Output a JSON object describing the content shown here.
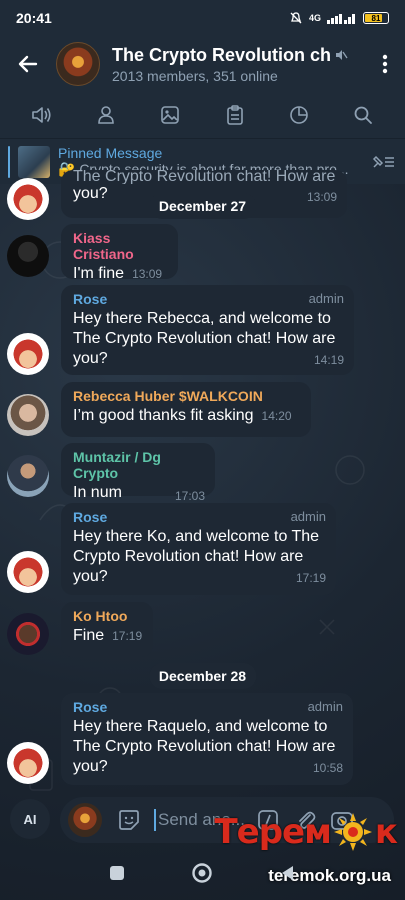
{
  "status_bar": {
    "time": "20:41",
    "network": "4G",
    "battery": "81"
  },
  "header": {
    "title": "The Crypto Revolution chat",
    "subtitle": "2013 members, 351 online",
    "icons": [
      "back-arrow-icon",
      "muted-icon",
      "more-vert-icon"
    ]
  },
  "tabs": [
    {
      "icon": "speaker-icon"
    },
    {
      "icon": "person-icon"
    },
    {
      "icon": "image-icon"
    },
    {
      "icon": "clipboard-icon"
    },
    {
      "icon": "pie-chart-icon"
    },
    {
      "icon": "search-icon"
    }
  ],
  "pinned": {
    "title": "Pinned Message",
    "body": "🔐 Crypto security is about far more than pro..."
  },
  "messages": {
    "top_partial": {
      "text": "you?",
      "time": "13:09",
      "partial_text": "The Crypto Revolution chat! How are"
    },
    "date1": "December 27",
    "m1": {
      "sender": "Kiass Cristiano",
      "sender_color": "#f0668a",
      "text": "I'm fine",
      "time": "13:09"
    },
    "m2": {
      "sender": "Rose",
      "sender_color": "#5fa9e0",
      "role": "admin",
      "text": "Hey there Rebecca, and welcome to The Crypto Revolution chat! How are you?",
      "time": "14:19"
    },
    "m3": {
      "sender": "Rebecca Huber $WALKCOIN",
      "sender_color": "#f0a95a",
      "text": "I’m good thanks fit asking",
      "time": "14:20"
    },
    "m4": {
      "sender": "Muntazir / Dg Crypto",
      "sender_color": "#5ec4a8",
      "text": "In num",
      "time": "17:03"
    },
    "m5": {
      "sender": "Rose",
      "sender_color": "#5fa9e0",
      "role": "admin",
      "text": "Hey there Ko, and welcome to The Crypto Revolution chat! How are you?",
      "time": "17:19"
    },
    "m6": {
      "sender": "Ko Htoo",
      "sender_color": "#f0a95a",
      "text": "Fine",
      "time": "17:19"
    },
    "date2": "December 28",
    "m7": {
      "sender": "Rose",
      "sender_color": "#5fa9e0",
      "role": "admin",
      "text": "Hey there Raquelo, and welcome to The Crypto Revolution chat! How are you?",
      "time": "10:58"
    }
  },
  "composer": {
    "ai_label": "AI",
    "placeholder": "Send ano..."
  },
  "watermark": {
    "brand": "Теремок",
    "url": "teremok.org.ua"
  },
  "colors": {
    "accent": "#5fa9e0",
    "bubble": "#1e2834",
    "header": "#1f2b38"
  }
}
